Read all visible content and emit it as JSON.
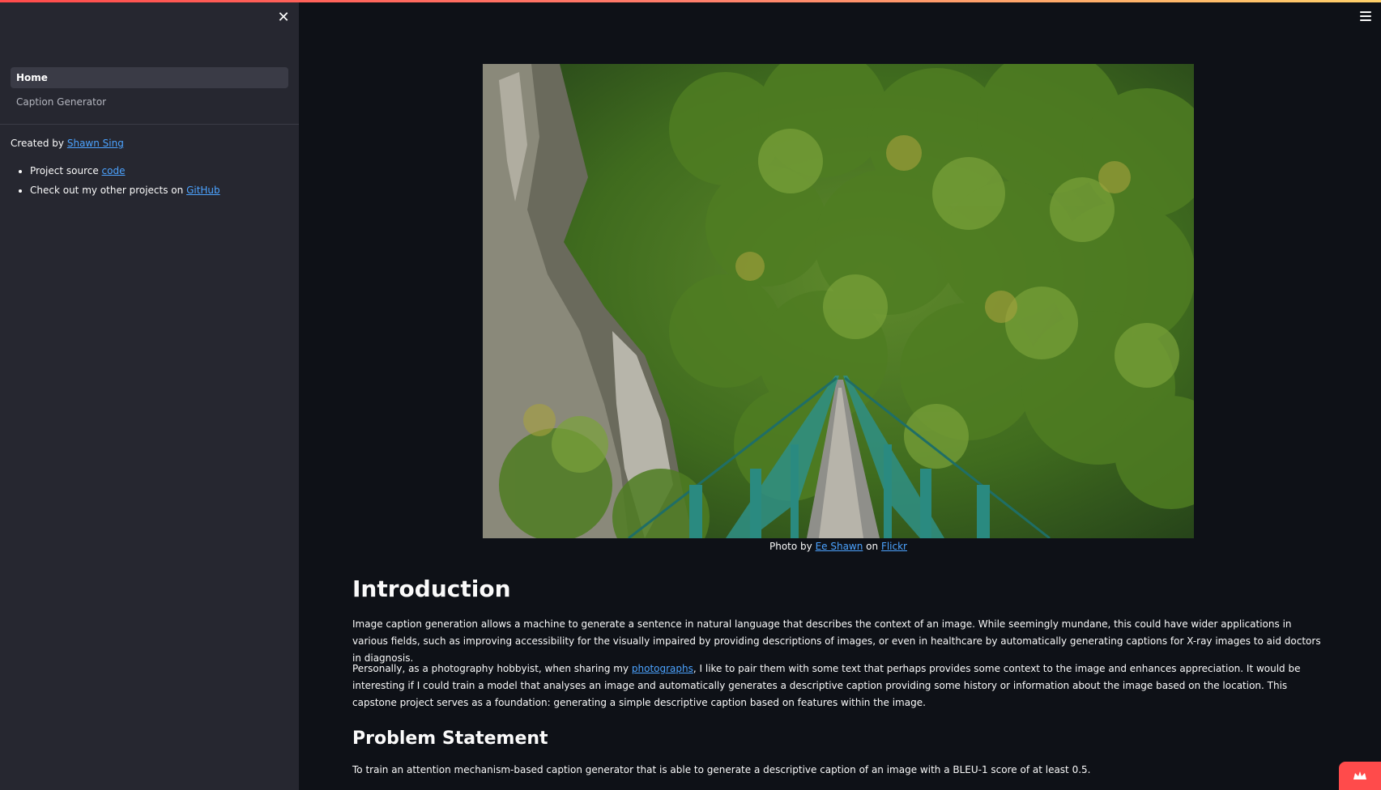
{
  "sidebar": {
    "close_icon": "close-icon",
    "nav": [
      {
        "label": "Home",
        "active": true
      },
      {
        "label": "Caption Generator",
        "active": false
      }
    ],
    "created_by_prefix": "Created by ",
    "author": "Shawn Sing",
    "links": [
      {
        "prefix": "Project source ",
        "link": "code"
      },
      {
        "prefix": "Check out my other projects on ",
        "link": "GitHub"
      }
    ]
  },
  "header": {
    "menu_icon": "hamburger-menu-icon"
  },
  "hero": {
    "caption_prefix": "Photo by ",
    "photographer": "Ee Shawn",
    "caption_mid": " on ",
    "source": "Flickr"
  },
  "intro": {
    "title": "Introduction",
    "p1": "Image caption generation allows a machine to generate a sentence in natural language that describes the context of an image. While seemingly mundane, this could have wider applications in various fields, such as improving accessibility for the visually impaired by providing descriptions of images, or even in healthcare by automatically generating captions for X-ray images to aid doctors in diagnosis.",
    "p2_before": "Personally, as a photography hobbyist, when sharing my ",
    "p2_link": "photographs",
    "p2_after": ", I like to pair them with some text that perhaps provides some context to the image and enhances appreciation. It would be interesting if I could train a model that analyses an image and automatically generates a descriptive caption providing some history or information about the image based on the location. This capstone project serves as a foundation: generating a simple descriptive caption based on features within the image."
  },
  "problem": {
    "title": "Problem Statement",
    "text": "To train an attention mechanism-based caption generator that is able to generate a descriptive caption of an image with a BLEU-1 score of at least 0.5."
  },
  "colors": {
    "background": "#0e1117",
    "sidebar": "#262730",
    "link": "#4ca3ff",
    "accent": "#ff4b4b"
  }
}
